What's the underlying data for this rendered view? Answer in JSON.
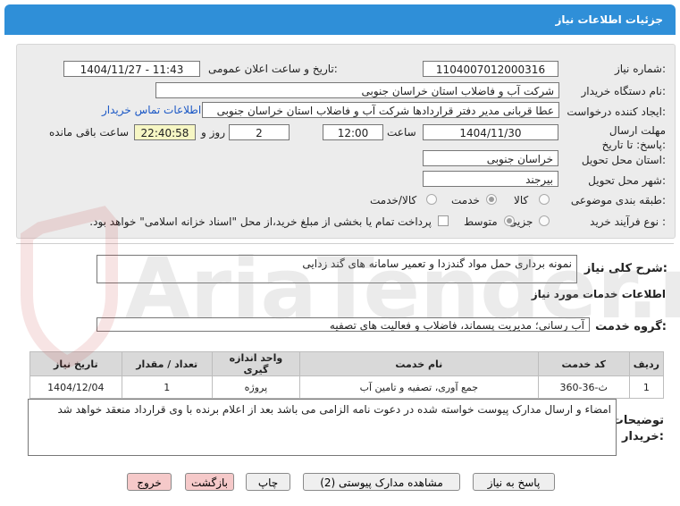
{
  "header": {
    "title": "جزئیات اطلاعات نیاز"
  },
  "form": {
    "need_number": {
      "label": "شماره نیاز:",
      "value": "1104007012000316"
    },
    "announce_datetime": {
      "label": "تاریخ و ساعت اعلان عمومی:",
      "value": "1404/11/27 - 11:43"
    },
    "buyer_org": {
      "label": "نام دستگاه خریدار:",
      "value": "شرکت آب و فاضلاب استان خراسان جنوبی"
    },
    "requester": {
      "label": "ایجاد کننده درخواست:",
      "value": "عطا قربانی مدیر دفتر قراردادها شرکت آب و فاضلاب استان خراسان جنوبی"
    },
    "buyer_contact_link": "اطلاعات تماس خریدار",
    "deadline": {
      "label": "مهلت ارسال پاسخ: تا تاریخ:",
      "date": "1404/11/30",
      "time_label": "ساعت",
      "time": "12:00",
      "days": "2",
      "days_label": "روز و",
      "remaining": "22:40:58",
      "remaining_label": "ساعت باقی مانده"
    },
    "delivery_province": {
      "label": "استان محل تحویل:",
      "value": "خراسان جنوبی"
    },
    "delivery_city": {
      "label": "شهر محل تحویل:",
      "value": "بیرجند"
    },
    "category": {
      "label": "طبقه بندی موضوعی:",
      "options": [
        "کالا",
        "خدمت",
        "کالا/خدمت"
      ],
      "selected": "خدمت"
    },
    "purchase_type": {
      "label": "نوع فرآیند خرید :",
      "options": [
        "جزیی",
        "متوسط"
      ],
      "selected": "متوسط",
      "payment_note": "پرداخت تمام یا بخشی از مبلغ خرید،از محل \"اسناد خزانه اسلامی\" خواهد بود."
    }
  },
  "summary": {
    "label": "شرح کلی نیاز:",
    "value": "نمونه برداری حمل مواد گندزدا و تعمیر سامانه های گند زدایی"
  },
  "services_section": {
    "title": "اطلاعات خدمات مورد نیاز"
  },
  "service_group": {
    "label": "گروه خدمت:",
    "value": "آب رسانی؛ مدیریت پسماند، فاضلاب و فعالیت های تصفیه"
  },
  "table": {
    "headers": [
      "ردیف",
      "کد خدمت",
      "نام خدمت",
      "واحد اندازه گیری",
      "تعداد / مقدار",
      "تاریخ نیاز"
    ],
    "rows": [
      [
        "1",
        "ث-36-360",
        "جمع آوری، تصفیه و تامین آب",
        "پروژه",
        "1",
        "1404/12/04"
      ]
    ]
  },
  "buyer_notes": {
    "label": "توضیحات خریدار:",
    "value": "امضاء و ارسال مدارک پیوست خواسته شده در دعوت نامه الزامی می باشد بعد از اعلام برنده با وی قرارداد منعقد خواهد شد"
  },
  "buttons": {
    "reply": "پاسخ به نیاز",
    "attachments": "مشاهده مدارک پیوستی (2)",
    "print": "چاپ",
    "back": "بازگشت",
    "exit": "خروج"
  },
  "watermark": {
    "text": "AriaTender.net"
  },
  "colors": {
    "header": "#2f8fd8",
    "link": "#1a57c5",
    "remaining_bg": "#f6f6c4",
    "pink_button": "#f5c9c9"
  }
}
